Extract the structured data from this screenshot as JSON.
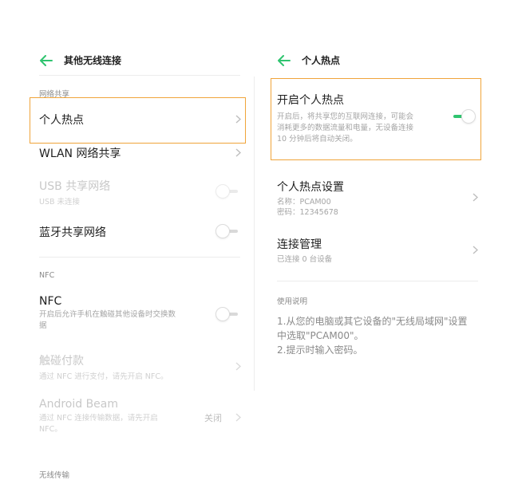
{
  "left": {
    "title": "其他无线连接",
    "section_sharing": "网络共享",
    "hotspot": {
      "label": "个人热点"
    },
    "wlan_share": {
      "label": "WLAN 网络共享"
    },
    "usb_share": {
      "label": "USB 共享网络",
      "sub": "USB 未连接"
    },
    "bt_share": {
      "label": "蓝牙共享网络"
    },
    "section_nfc": "NFC",
    "nfc": {
      "label": "NFC",
      "sub_line1": "开启后允许手机在触碰其他设备时交换数",
      "sub_line2": "据"
    },
    "touch_pay": {
      "label": "触碰付款",
      "sub": "通过 NFC 进行支付，请先开启 NFC。"
    },
    "android_beam": {
      "label": "Android Beam",
      "sub_line1": "通过 NFC 连接传输数据，请先开启",
      "sub_line2": "NFC。",
      "value": "关闭"
    },
    "section_wireless": "无线传输"
  },
  "right": {
    "title": "个人热点",
    "enable": {
      "label": "开启个人热点",
      "desc_line1": "开启后，将共享您的互联网连接，可能会",
      "desc_line2": "消耗更多的数据流量和电量，无设备连接",
      "desc_line3": "10 分钟后将自动关闭。",
      "state": "on"
    },
    "settings": {
      "label": "个人热点设置",
      "name_line": "名称：PCAM00",
      "pwd_line": "密码：12345678"
    },
    "manage": {
      "label": "连接管理",
      "sub": "已连接 0 台设备"
    },
    "usage_header": "使用说明",
    "usage_line1": "1.从您的电脑或其它设备的\"无线局域网\"设置",
    "usage_line2": "中选取\"PCAM00\"。",
    "usage_line3": "2.提示时输入密码。"
  },
  "colors": {
    "accent_green": "#2fc46f",
    "highlight_orange": "#f0a43a"
  },
  "icons": {
    "back": "back-arrow-icon",
    "chevron": "chevron-right-icon"
  }
}
